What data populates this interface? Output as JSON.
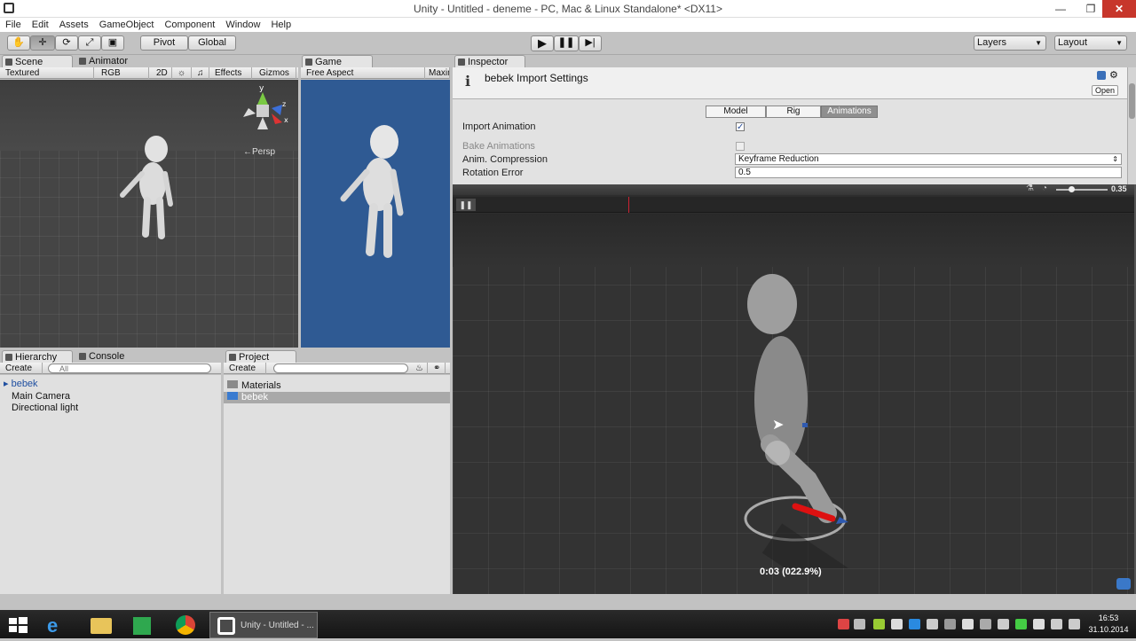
{
  "window": {
    "title": "Unity - Untitled - deneme - PC, Mac & Linux Standalone* <DX11>"
  },
  "menu": [
    "File",
    "Edit",
    "Assets",
    "GameObject",
    "Component",
    "Window",
    "Help"
  ],
  "toolbar": {
    "pivot": "Pivot",
    "global": "Global",
    "layers": "Layers",
    "layout": "Layout"
  },
  "scene": {
    "tabs": [
      "Scene",
      "Animator"
    ],
    "bar": {
      "shading": "Textured",
      "channel": "RGB",
      "mode2d": "2D",
      "effects": "Effects",
      "gizmos": "Gizmos"
    },
    "persp": "Persp",
    "axis": {
      "y": "y",
      "z": "z",
      "x": "x"
    }
  },
  "game": {
    "tab": "Game",
    "aspect": "Free Aspect",
    "maximize": "Maxin"
  },
  "hierarchy": {
    "tabs": [
      "Hierarchy",
      "Console"
    ],
    "create": "Create",
    "search_placeholder": "All",
    "items": [
      "bebek",
      "Main Camera",
      "Directional light"
    ]
  },
  "project": {
    "tab": "Project",
    "create": "Create",
    "items": [
      "Materials",
      "bebek"
    ]
  },
  "inspector": {
    "tab": "Inspector",
    "title": "bebek Import Settings",
    "open": "Open",
    "tabs": [
      "Model",
      "Rig",
      "Animations"
    ],
    "active_tab": "Animations",
    "rows": {
      "import_animation": "Import Animation",
      "bake_animations": "Bake Animations",
      "anim_compression": "Anim. Compression",
      "rotation_error": "Rotation Error"
    },
    "import_animation_checked": true,
    "compression_value": "Keyframe Reduction",
    "rotation_error_value": "0.5",
    "preview_speed": "0.35",
    "time_label": "0:03 (022.9%)"
  },
  "taskbar": {
    "unity_label": "Unity - Untitled - ...",
    "time": "16:53",
    "date": "31.10.2014"
  }
}
